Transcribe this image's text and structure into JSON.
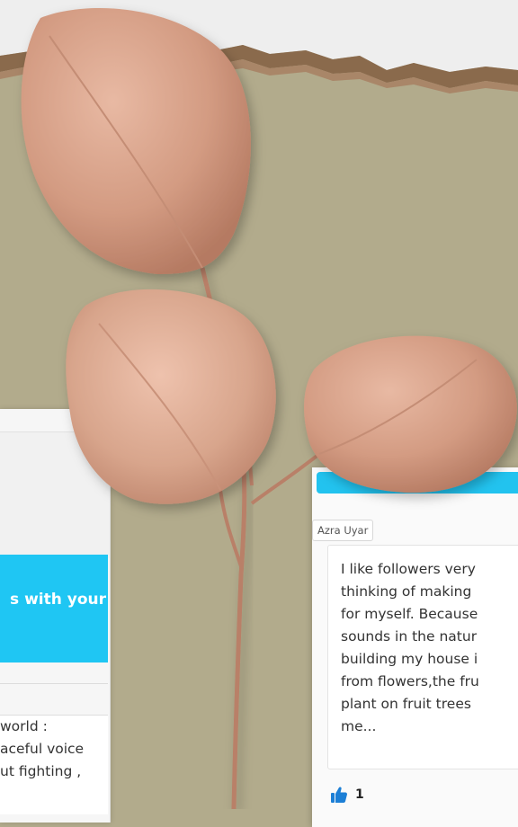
{
  "left_card": {
    "banner_text": "s with your",
    "story_lines": [
      "world :",
      "aceful voice",
      "ut fighting ,"
    ]
  },
  "right_card": {
    "author": "Azra Uyar",
    "story_lines": [
      "I like followers very",
      "thinking of making",
      "for myself. Because",
      "sounds in the natur",
      "building my house i",
      "from flowers,the fru",
      "plant on fruit trees",
      "me..."
    ],
    "likes": "1"
  },
  "colors": {
    "background": "#b2ab8c",
    "accent": "#1fc6f3",
    "leaf": "#d9a48c"
  }
}
